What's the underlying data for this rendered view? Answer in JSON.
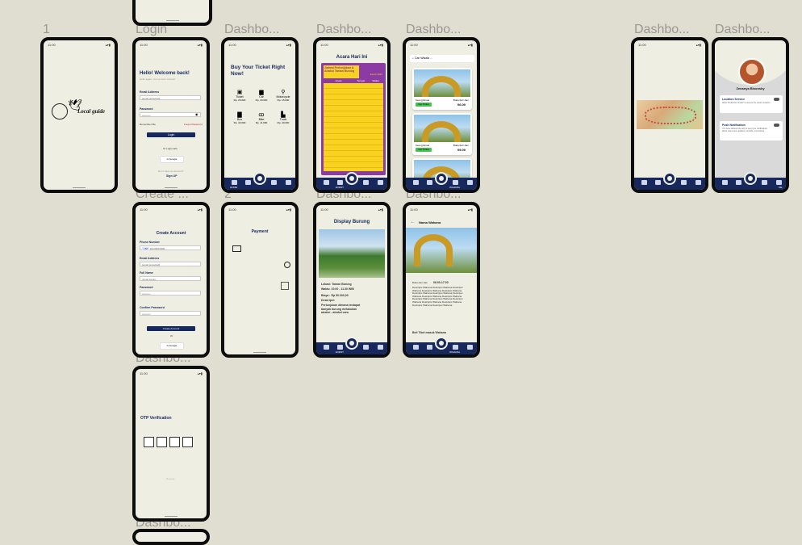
{
  "frames": {
    "f1": "1",
    "login": "Login",
    "dash1": "Dashbo...",
    "dash2": "Dashbo...",
    "dash3": "Dashbo...",
    "dash4": "Dashbo...",
    "dash5": "Dashbo...",
    "create": "Create ...",
    "f2": "2",
    "dash6": "Dashbo...",
    "dash7": "Dashbo...",
    "dash8": "Dashbo...",
    "dash9": "Dashbo..."
  },
  "status": {
    "time": "11:00"
  },
  "splash": {
    "logo_text": "Local guide"
  },
  "login": {
    "title": "Hello! Welcome back!",
    "subtitle": "Hello again, You've been missed!",
    "email_label": "Email Address",
    "email_value": "[email protected]",
    "password_label": "Password",
    "password_value": "••••••••••",
    "remember": "Remember Me",
    "forgot": "Forgot Password",
    "login_btn": "Login",
    "or": "Or Login with",
    "google": "Google",
    "no_account": "Don't have an account?",
    "signup": "Sign UP"
  },
  "ticket": {
    "title": "Buy Your Ticket Right Now!",
    "items": [
      {
        "name": "Ticket",
        "price": "Rp. 25.000"
      },
      {
        "name": "Car",
        "price": "Rp. 20.000"
      },
      {
        "name": "Motorcycle",
        "price": "Rp. 15.000"
      },
      {
        "name": "Bus",
        "price": "Rp. 40.000"
      },
      {
        "name": "Bike",
        "price": "Rp. 11.000"
      },
      {
        "name": "Truck",
        "price": "Rp. 40.000"
      }
    ],
    "nav_label": "HOME"
  },
  "event": {
    "title": "Acara Hari Ini",
    "poster_title": "Jadwal Pertunjukan & Atraksi",
    "poster_title2": "Taman Burung",
    "poster_tag": "Event 2024",
    "headers": [
      "Acara",
      "Tempat",
      "Waktu"
    ],
    "nav_label": "EVENT"
  },
  "wahana_list": {
    "search_placeholder": "Cari Wisata ...",
    "cards": [
      {
        "name": "Keong Emas",
        "status": "Buka dari Jam",
        "hours": "06.00",
        "badge": "Get Ticket"
      },
      {
        "name": "Keong Emas",
        "status": "Buka dari Jam",
        "hours": "09.00",
        "badge": "Get Ticket"
      }
    ],
    "nav_label": "WAHANA"
  },
  "profile": {
    "name": "Zenanya Bisonsky",
    "location_title": "Location Service",
    "location_desc": "Allow \"Reflection Guide\" to access the device location",
    "push_title": "Push Notification",
    "push_desc": "You have allowed the app to send you notifications about new event updates, reminds, promotions",
    "nav_label": "ME"
  },
  "create": {
    "title": "Create Account",
    "phone_label": "Phone Number",
    "phone_code": "+62",
    "phone_value": "81234567890",
    "email_label": "Email Address",
    "email_value": "[email protected]",
    "name_label": "Full Name",
    "name_value": "Jonas Lucas",
    "password_label": "Password",
    "password_value": "••••••••••",
    "confirm_label": "Confirm Password",
    "confirm_value": "••••••••••",
    "create_btn": "Create Account",
    "or": "Or",
    "google": "Google"
  },
  "payment": {
    "title": "Payment"
  },
  "display": {
    "title": "Display Burung",
    "lokasi": "Lokasi: Taman Burung",
    "waktu": "Waktu: 10.00 - 11.30 WIB",
    "biaya": "Biaya : Rp 50.000,00",
    "deskripsi": "Deskripsi:",
    "desc_text": "Pertunjukan dimana terdapat banyak burung melakukan atraksi - atraksi  cara",
    "nav_label": "EVENT"
  },
  "detail": {
    "title": "Nama Wahana",
    "hours_label": "Buka dari Jam",
    "hours": "06.00-17.00",
    "desc": "Deskripsi Wahana Deskripsi Wahana Deskripsi Wahana Deskripsi Wahana Deskripsi Wahana Deskripsi Wahana Deskripsi Wahana Deskripsi Wahana Deskripsi Wahana Deskripsi Wahana Deskripsi Wahana Deskripsi Wahana Deskripsi Wahana Deskripsi Wahana Deskripsi Wahana Deskripsi Wahana Deskripsi Wahana",
    "buy": "Beli Tiket masuk Wahana",
    "nav_label": "WAHANA"
  },
  "otp": {
    "title": "OTP Verification",
    "resend": "Resend"
  }
}
